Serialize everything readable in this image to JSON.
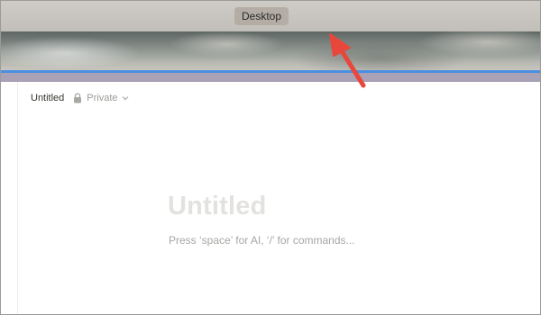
{
  "titlebar": {
    "label": "Desktop"
  },
  "breadcrumb": {
    "page_title": "Untitled",
    "visibility": "Private",
    "visibility_icon": "lock-icon",
    "dropdown_icon": "chevron-down-icon"
  },
  "editor": {
    "title_placeholder": "Untitled",
    "body_placeholder": "Press ‘space’ for AI, ‘/’ for commands..."
  },
  "annotation": {
    "icon": "red-arrow-icon",
    "color": "#e8473c"
  },
  "colors": {
    "accent_blue": "#4b8fe0",
    "separator_purple": "#a9a2b6"
  }
}
